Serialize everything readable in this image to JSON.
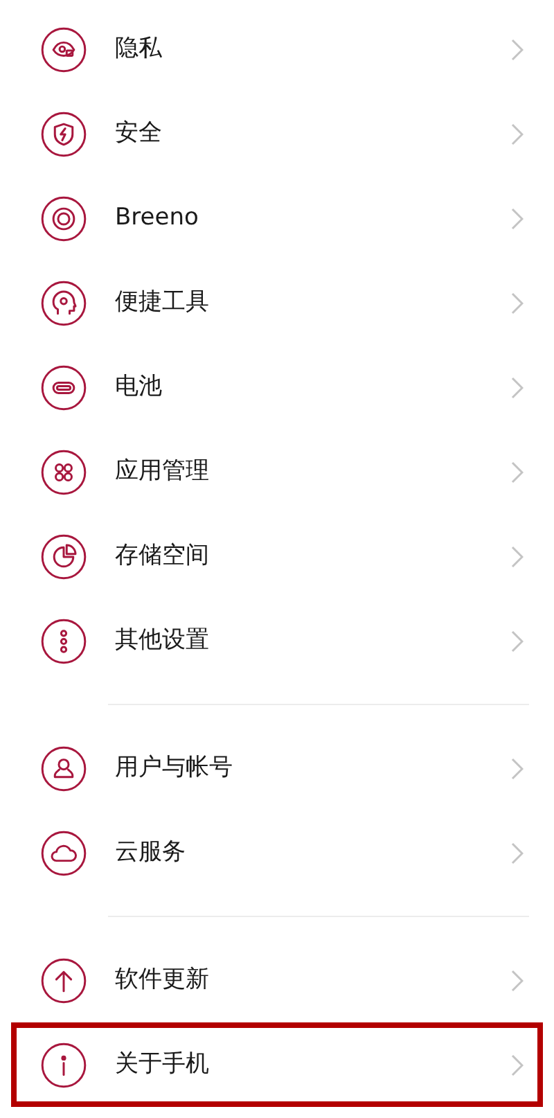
{
  "groups": [
    {
      "items": [
        {
          "label": "隐私",
          "highlighted": false
        },
        {
          "label": "安全",
          "highlighted": false
        },
        {
          "label": "Breeno",
          "highlighted": false
        },
        {
          "label": "便捷工具",
          "highlighted": false
        },
        {
          "label": "电池",
          "highlighted": false
        },
        {
          "label": "应用管理",
          "highlighted": false
        },
        {
          "label": "存储空间",
          "highlighted": false
        },
        {
          "label": "其他设置",
          "highlighted": false
        }
      ]
    },
    {
      "items": [
        {
          "label": "用户与帐号",
          "highlighted": false
        },
        {
          "label": "云服务",
          "highlighted": false
        }
      ]
    },
    {
      "items": [
        {
          "label": "软件更新",
          "highlighted": false
        },
        {
          "label": "关于手机",
          "highlighted": true
        }
      ]
    }
  ]
}
